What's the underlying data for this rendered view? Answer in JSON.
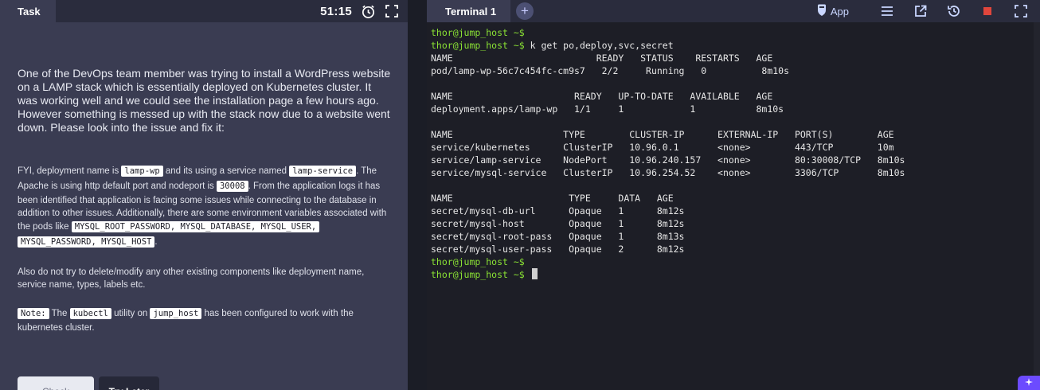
{
  "task_panel": {
    "tab_label": "Task",
    "timer": "51:15",
    "intro": "One of the DevOps team member was trying to install a WordPress website on a LAMP stack which is essentially deployed on Kubernetes cluster. It was working well and we could see the installation page a few hours ago. However something is messed up with the stack now due to a website went down. Please look into the issue and fix it:",
    "fyi": {
      "t1": "FYI, deployment name is ",
      "c1": "lamp-wp",
      "t2": " and its using a service named ",
      "c2": "lamp-service",
      "t3": ". The Apache is using http default port and nodeport is ",
      "c3": "30008",
      "t4": ". From the application logs it has been identified that application is facing some issues while connecting to the database in addition to other issues. Additionally, there are some environment variables associated with the pods like ",
      "c4": "MYSQL_ROOT_PASSWORD, MYSQL_DATABASE, MYSQL_USER,",
      "c5": "MYSQL_PASSWORD, MYSQL_HOST",
      "t5": "."
    },
    "also": "Also do not try to delete/modify any other existing components like deployment name, service name, types, labels etc.",
    "note": {
      "label": "Note:",
      "t1": " The ",
      "c1": "kubectl",
      "t2": " utility on ",
      "c2": "jump_host",
      "t3": " has been configured to work with the kubernetes cluster."
    },
    "buttons": {
      "check": "Check",
      "try_later": "Try Later"
    }
  },
  "terminal": {
    "tab_label": "Terminal 1",
    "add_tab": "+",
    "app_label": "App",
    "lines": [
      {
        "prompt": "thor@jump_host ~$",
        "text": ""
      },
      {
        "prompt": "thor@jump_host ~$",
        "text": " k get po,deploy,svc,secret"
      },
      {
        "prompt": "",
        "text": "NAME                          READY   STATUS    RESTARTS   AGE"
      },
      {
        "prompt": "",
        "text": "pod/lamp-wp-56c7c454fc-cm9s7   2/2     Running   0          8m10s"
      },
      {
        "prompt": "",
        "text": ""
      },
      {
        "prompt": "",
        "text": "NAME                      READY   UP-TO-DATE   AVAILABLE   AGE"
      },
      {
        "prompt": "",
        "text": "deployment.apps/lamp-wp   1/1     1            1           8m10s"
      },
      {
        "prompt": "",
        "text": ""
      },
      {
        "prompt": "",
        "text": "NAME                    TYPE        CLUSTER-IP      EXTERNAL-IP   PORT(S)        AGE"
      },
      {
        "prompt": "",
        "text": "service/kubernetes      ClusterIP   10.96.0.1       <none>        443/TCP        10m"
      },
      {
        "prompt": "",
        "text": "service/lamp-service    NodePort    10.96.240.157   <none>        80:30008/TCP   8m10s"
      },
      {
        "prompt": "",
        "text": "service/mysql-service   ClusterIP   10.96.254.52    <none>        3306/TCP       8m10s"
      },
      {
        "prompt": "",
        "text": ""
      },
      {
        "prompt": "",
        "text": "NAME                     TYPE     DATA   AGE"
      },
      {
        "prompt": "",
        "text": "secret/mysql-db-url      Opaque   1      8m12s"
      },
      {
        "prompt": "",
        "text": "secret/mysql-host        Opaque   1      8m12s"
      },
      {
        "prompt": "",
        "text": "secret/mysql-root-pass   Opaque   1      8m13s"
      },
      {
        "prompt": "",
        "text": "secret/mysql-user-pass   Opaque   2      8m12s"
      },
      {
        "prompt": "thor@jump_host ~$",
        "text": ""
      },
      {
        "prompt": "thor@jump_host ~$",
        "text": " ",
        "cursor": true
      }
    ]
  },
  "colors": {
    "prompt": "#8ae234",
    "stop_icon": "#e0463c",
    "app_icon": "#c9d6ff",
    "badge": "#6c4bff"
  }
}
